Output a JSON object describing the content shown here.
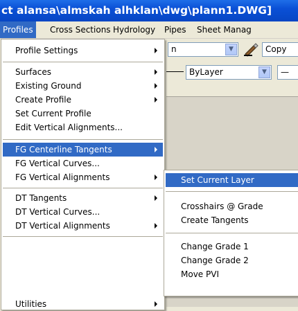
{
  "window": {
    "title": "ct alansa\\almskah alhklan\\dwg\\plann1.DWG]"
  },
  "menubar": {
    "items": [
      "Profiles",
      "Cross Sections",
      "Hydrology",
      "Pipes",
      "Sheet Manag"
    ]
  },
  "toolbar": {
    "combo1_value": "n",
    "copy_label": "Copy",
    "layer_value": "ByLayer"
  },
  "profiles_menu": {
    "items": [
      {
        "label": "Profile Settings"
      },
      {
        "label": "Surfaces"
      },
      {
        "label": "Existing Ground"
      },
      {
        "label": "Create Profile"
      },
      {
        "label": "Set Current Profile"
      },
      {
        "label": "Edit Vertical Alignments..."
      },
      {
        "label": "FG Centerline Tangents"
      },
      {
        "label": "FG Vertical Curves..."
      },
      {
        "label": "FG Vertical Alignments"
      },
      {
        "label": "DT Tangents"
      },
      {
        "label": "DT Vertical Curves..."
      },
      {
        "label": "DT Vertical Alignments"
      },
      {
        "label": "Utilities"
      }
    ]
  },
  "fg_submenu": {
    "items": [
      {
        "label": "Set Current Layer"
      },
      {
        "label": "Crosshairs @ Grade"
      },
      {
        "label": "Create Tangents"
      },
      {
        "label": "Change Grade 1"
      },
      {
        "label": "Change Grade 2"
      },
      {
        "label": "Move PVI"
      }
    ]
  },
  "colors": {
    "highlight": "#316AC5",
    "titlebar": "#0A50D6"
  }
}
